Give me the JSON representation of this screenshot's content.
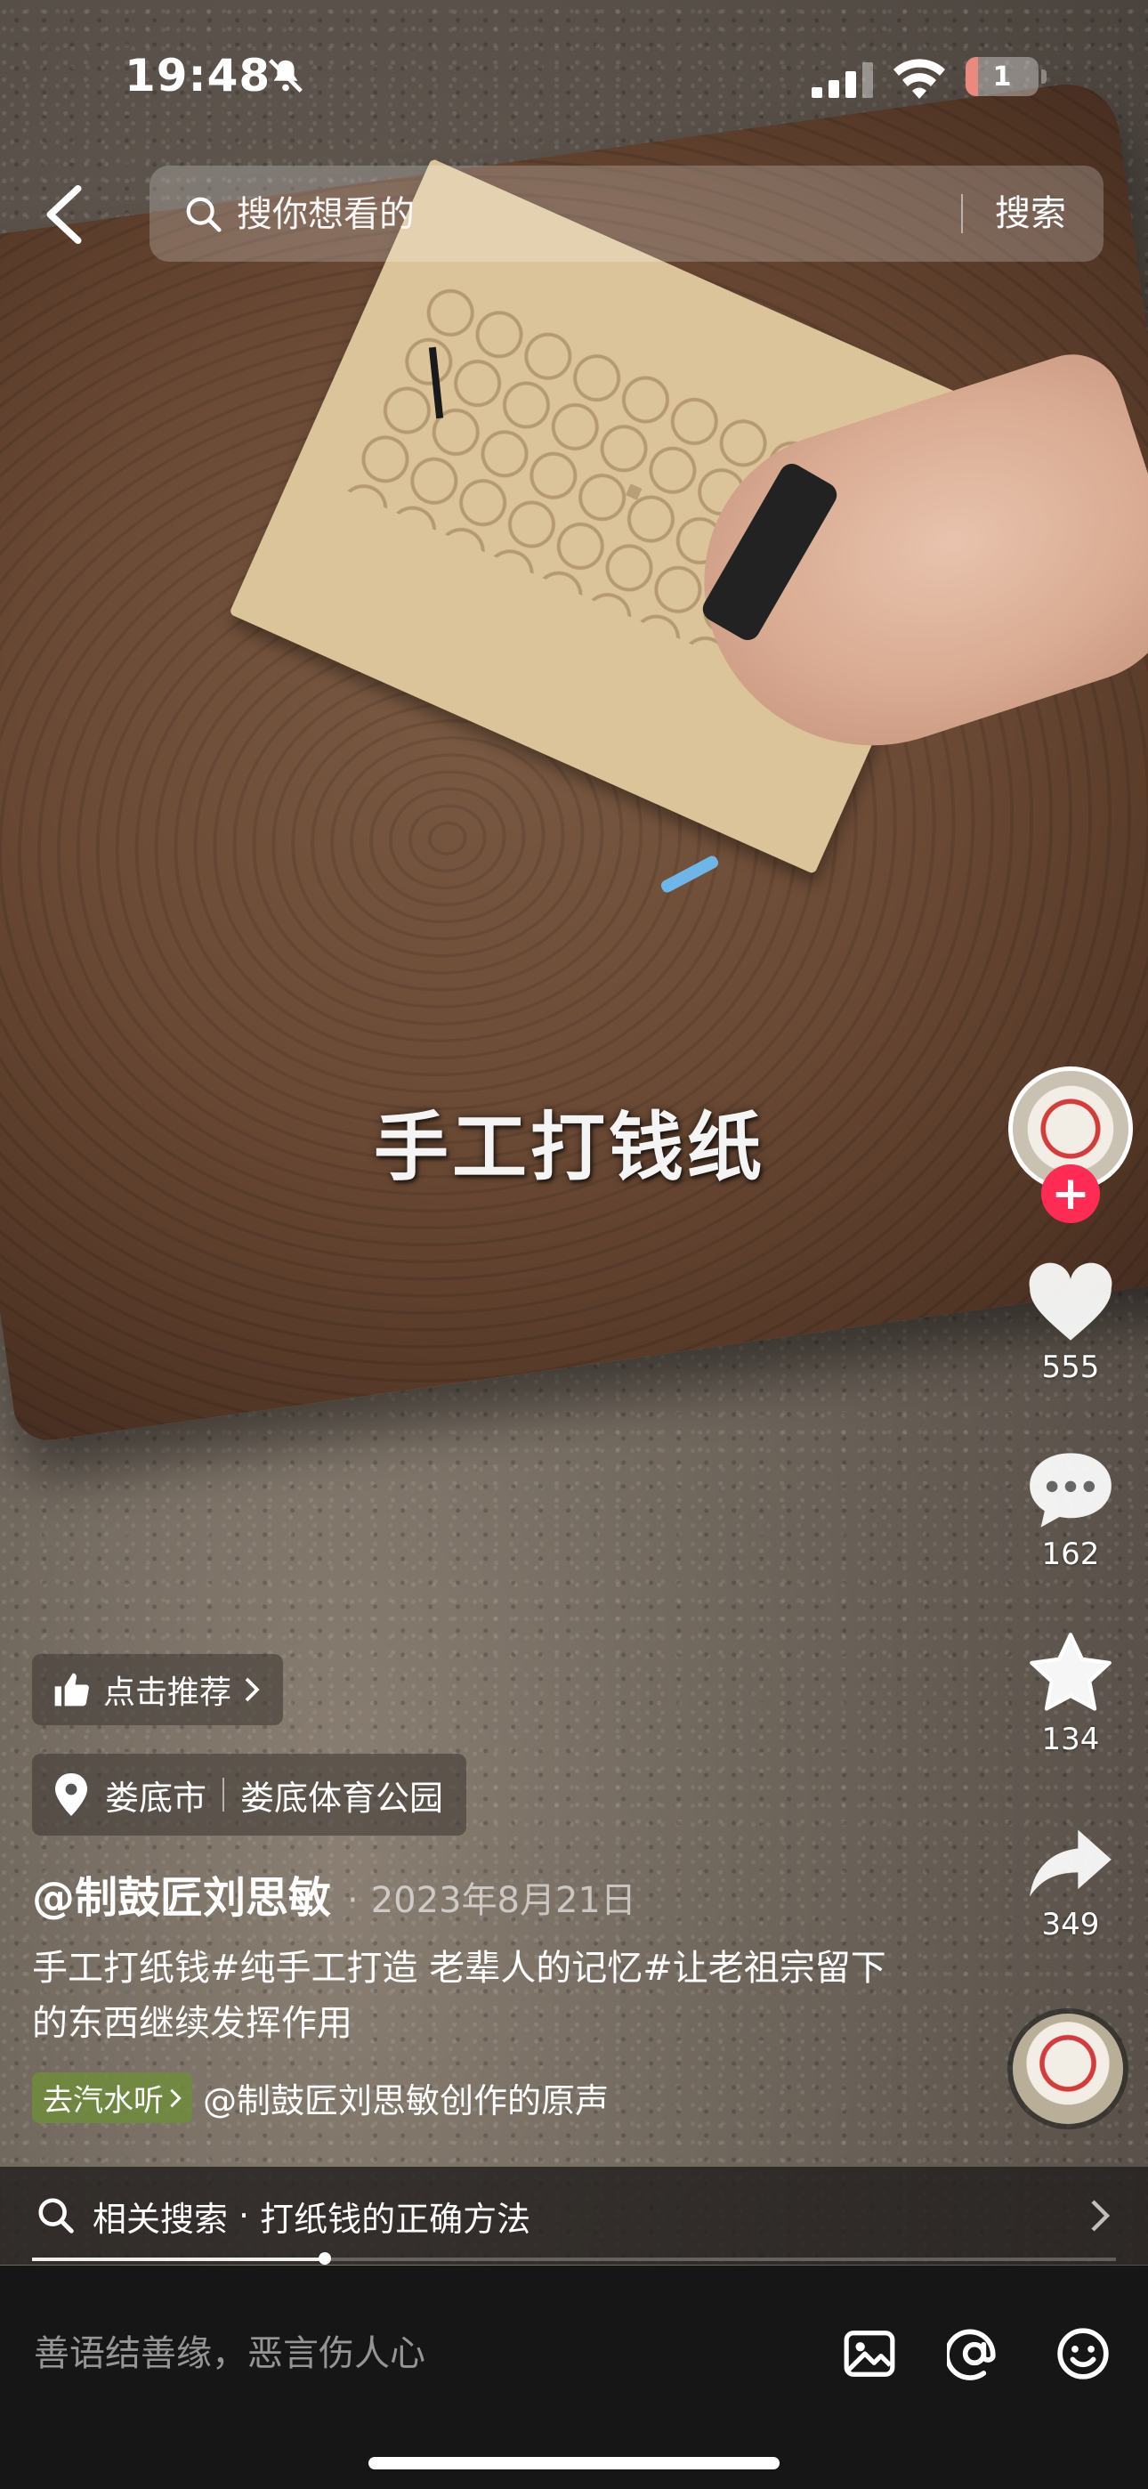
{
  "status_bar": {
    "time": "19:48",
    "battery": "1"
  },
  "search": {
    "placeholder": "搜你想看的",
    "button_label": "搜索"
  },
  "video": {
    "overlay_title": "手工打钱纸"
  },
  "actions": {
    "likes": "555",
    "comments": "162",
    "favorites": "134",
    "shares": "349"
  },
  "recommend": {
    "label": "点击推荐"
  },
  "location": {
    "city": "娄底市",
    "place": "娄底体育公园"
  },
  "post": {
    "author": "@制鼓匠刘思敏",
    "date": "2023年8月21日",
    "caption": "手工打纸钱#纯手工打造 老辈人的记忆#让老祖宗留下的东西继续发挥作用"
  },
  "music": {
    "tag": "去汽水听",
    "credit": "@制鼓匠刘思敏创作的原声"
  },
  "related_search": {
    "label": "相关搜索",
    "query": "打纸钱的正确方法"
  },
  "playback": {
    "progress": 0.27
  },
  "comment_bar": {
    "placeholder": "善语结善缘，恶言伤人心"
  },
  "colors": {
    "follow": "#fe2c55",
    "battery_low": "#e04a3a",
    "music_tag": "#6e8c3c"
  },
  "icons": [
    "back-icon",
    "search-icon",
    "bell-off-icon",
    "signal-icon",
    "wifi-icon",
    "heart-icon",
    "comment-icon",
    "star-icon",
    "share-icon",
    "thumbs-up-icon",
    "location-pin-icon",
    "image-icon",
    "at-icon",
    "emoji-icon"
  ]
}
